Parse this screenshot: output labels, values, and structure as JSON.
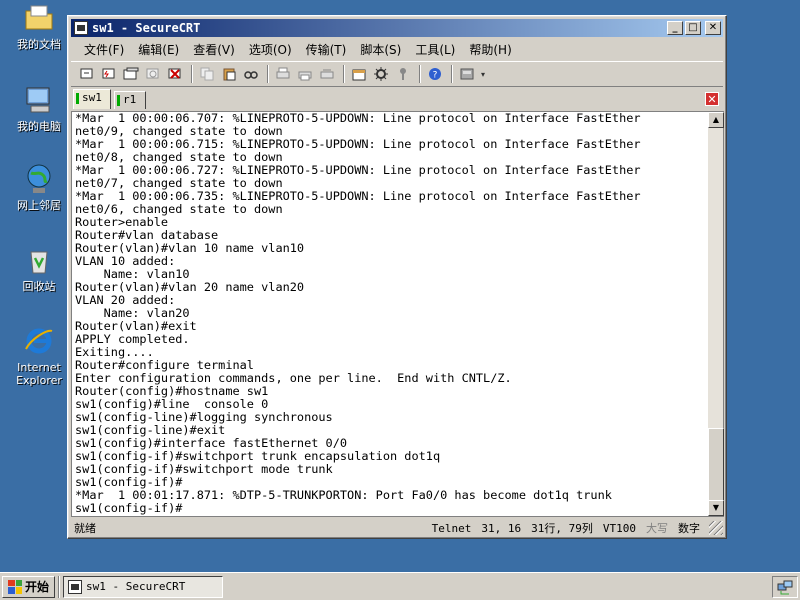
{
  "desktop": {
    "icons": [
      {
        "label": "我的文档"
      },
      {
        "label": "我的电脑"
      },
      {
        "label": "网上邻居"
      },
      {
        "label": "回收站"
      },
      {
        "label": "Internet Explorer"
      }
    ]
  },
  "window": {
    "title": "sw1 - SecureCRT",
    "menu": [
      "文件(F)",
      "编辑(E)",
      "查看(V)",
      "选项(O)",
      "传输(T)",
      "脚本(S)",
      "工具(L)",
      "帮助(H)"
    ],
    "tabs": [
      {
        "label": "sw1",
        "active": true
      },
      {
        "label": "r1",
        "active": false
      }
    ],
    "terminal_lines": [
      "*Mar  1 00:00:06.707: %LINEPROTO-5-UPDOWN: Line protocol on Interface FastEther",
      "net0/9, changed state to down",
      "*Mar  1 00:00:06.715: %LINEPROTO-5-UPDOWN: Line protocol on Interface FastEther",
      "net0/8, changed state to down",
      "*Mar  1 00:00:06.727: %LINEPROTO-5-UPDOWN: Line protocol on Interface FastEther",
      "net0/7, changed state to down",
      "*Mar  1 00:00:06.735: %LINEPROTO-5-UPDOWN: Line protocol on Interface FastEther",
      "net0/6, changed state to down",
      "Router>enable",
      "Router#vlan database",
      "Router(vlan)#vlan 10 name vlan10",
      "VLAN 10 added:",
      "    Name: vlan10",
      "Router(vlan)#vlan 20 name vlan20",
      "VLAN 20 added:",
      "    Name: vlan20",
      "Router(vlan)#exit",
      "APPLY completed.",
      "Exiting....",
      "Router#configure terminal",
      "Enter configuration commands, one per line.  End with CNTL/Z.",
      "Router(config)#hostname sw1",
      "sw1(config)#line  console 0",
      "sw1(config-line)#logging synchronous",
      "sw1(config-line)#exit",
      "sw1(config)#interface fastEthernet 0/0",
      "sw1(config-if)#switchport trunk encapsulation dot1q",
      "sw1(config-if)#switchport mode trunk",
      "sw1(config-if)#",
      "*Mar  1 00:01:17.871: %DTP-5-TRUNKPORTON: Port Fa0/0 has become dot1q trunk",
      "sw1(config-if)#"
    ],
    "status": {
      "ready": "就绪",
      "protocol": "Telnet",
      "cursor": "31,  16",
      "rows_cols": "31行, 79列",
      "terminal": "VT100",
      "caps": "大写",
      "num": "数字"
    }
  },
  "taskbar": {
    "start_label": "开始",
    "task_label": "sw1 - SecureCRT"
  }
}
